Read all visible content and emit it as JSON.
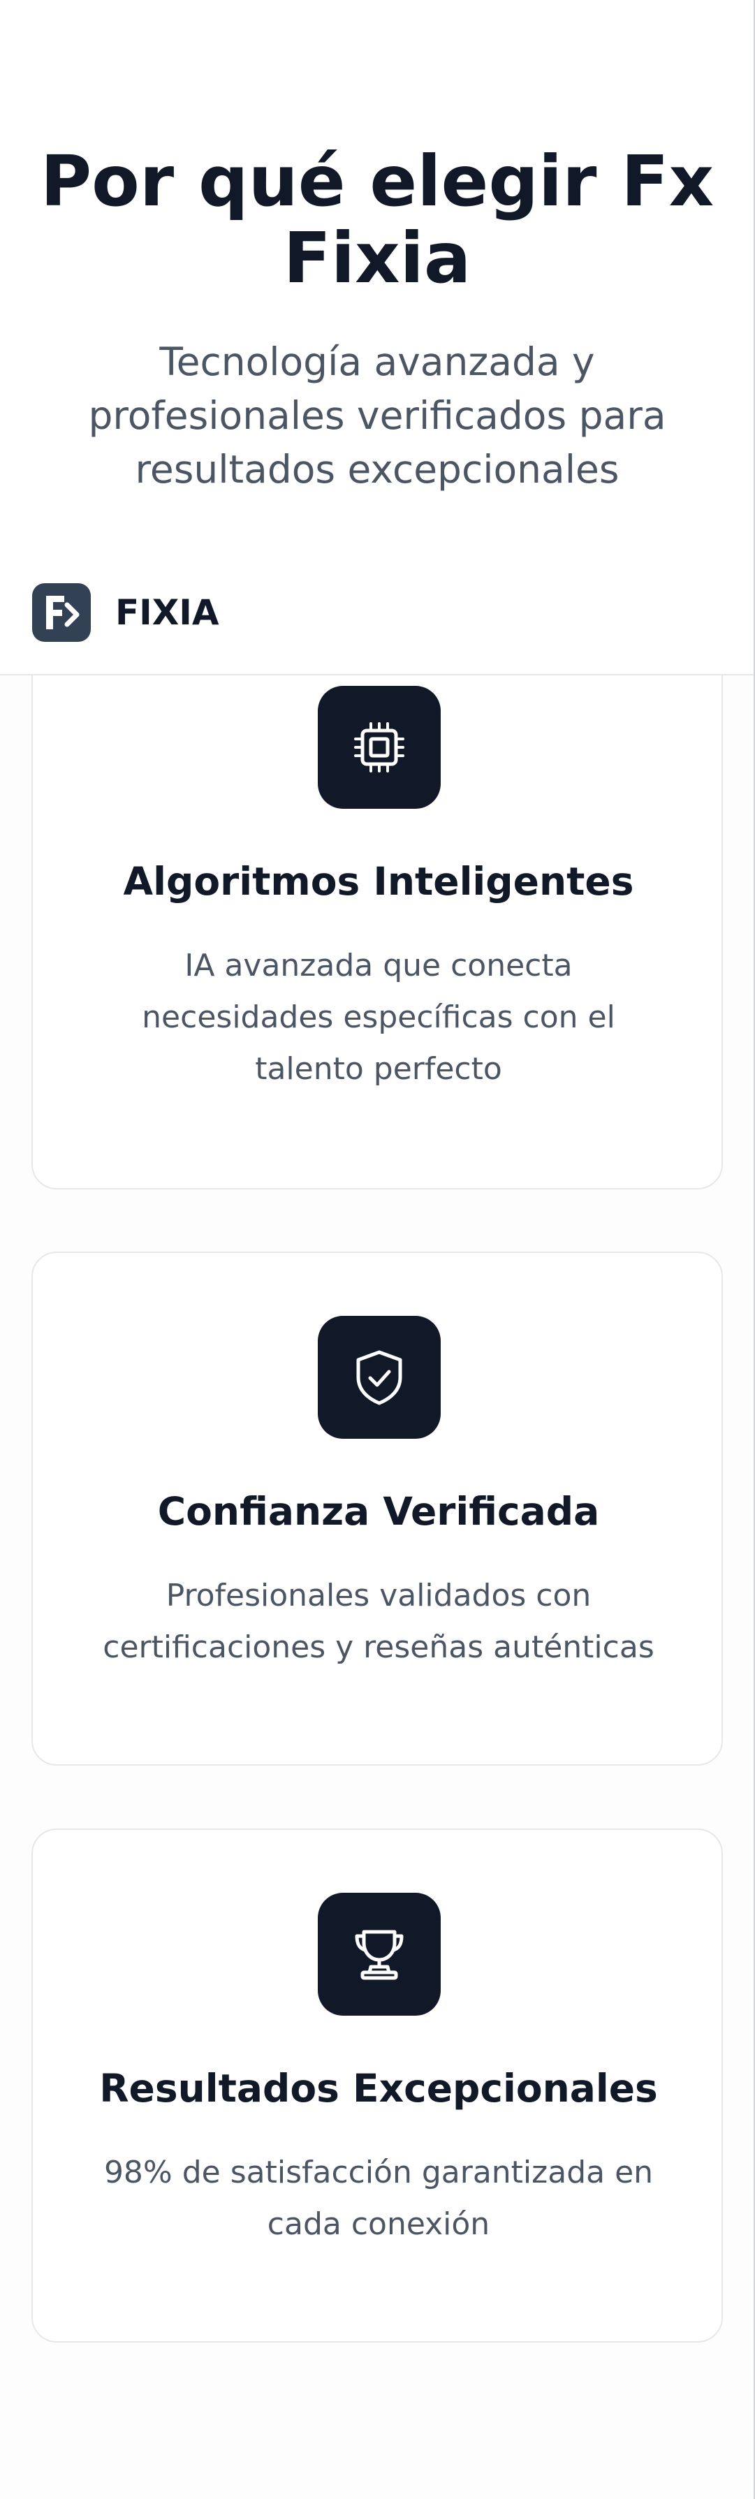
{
  "section": {
    "title": "Por qué elegir Fx Fixia",
    "subtitle": "Tecnología avanzada y profesionales verificados para resultados excepcionales"
  },
  "navbar": {
    "brand": "FIXIA",
    "logo_icon": "fixia-logo-icon"
  },
  "features": [
    {
      "icon": "cpu-chip-icon",
      "title": "Algoritmos Inteligentes",
      "description": "IA avanzada que conecta necesidades específicas con el talento perfecto"
    },
    {
      "icon": "shield-check-icon",
      "title": "Confianza Verificada",
      "description": "Profesionales validados con certificaciones y reseñas auténticas"
    },
    {
      "icon": "trophy-icon",
      "title": "Resultados Excepcionales",
      "description": "98% de satisfacción garantizada en cada conexión"
    }
  ],
  "colors": {
    "icon_background": "#111827",
    "logo_background": "#334155",
    "heading": "#111827",
    "body_text": "#4b5563",
    "card_border": "#e5e7eb"
  }
}
